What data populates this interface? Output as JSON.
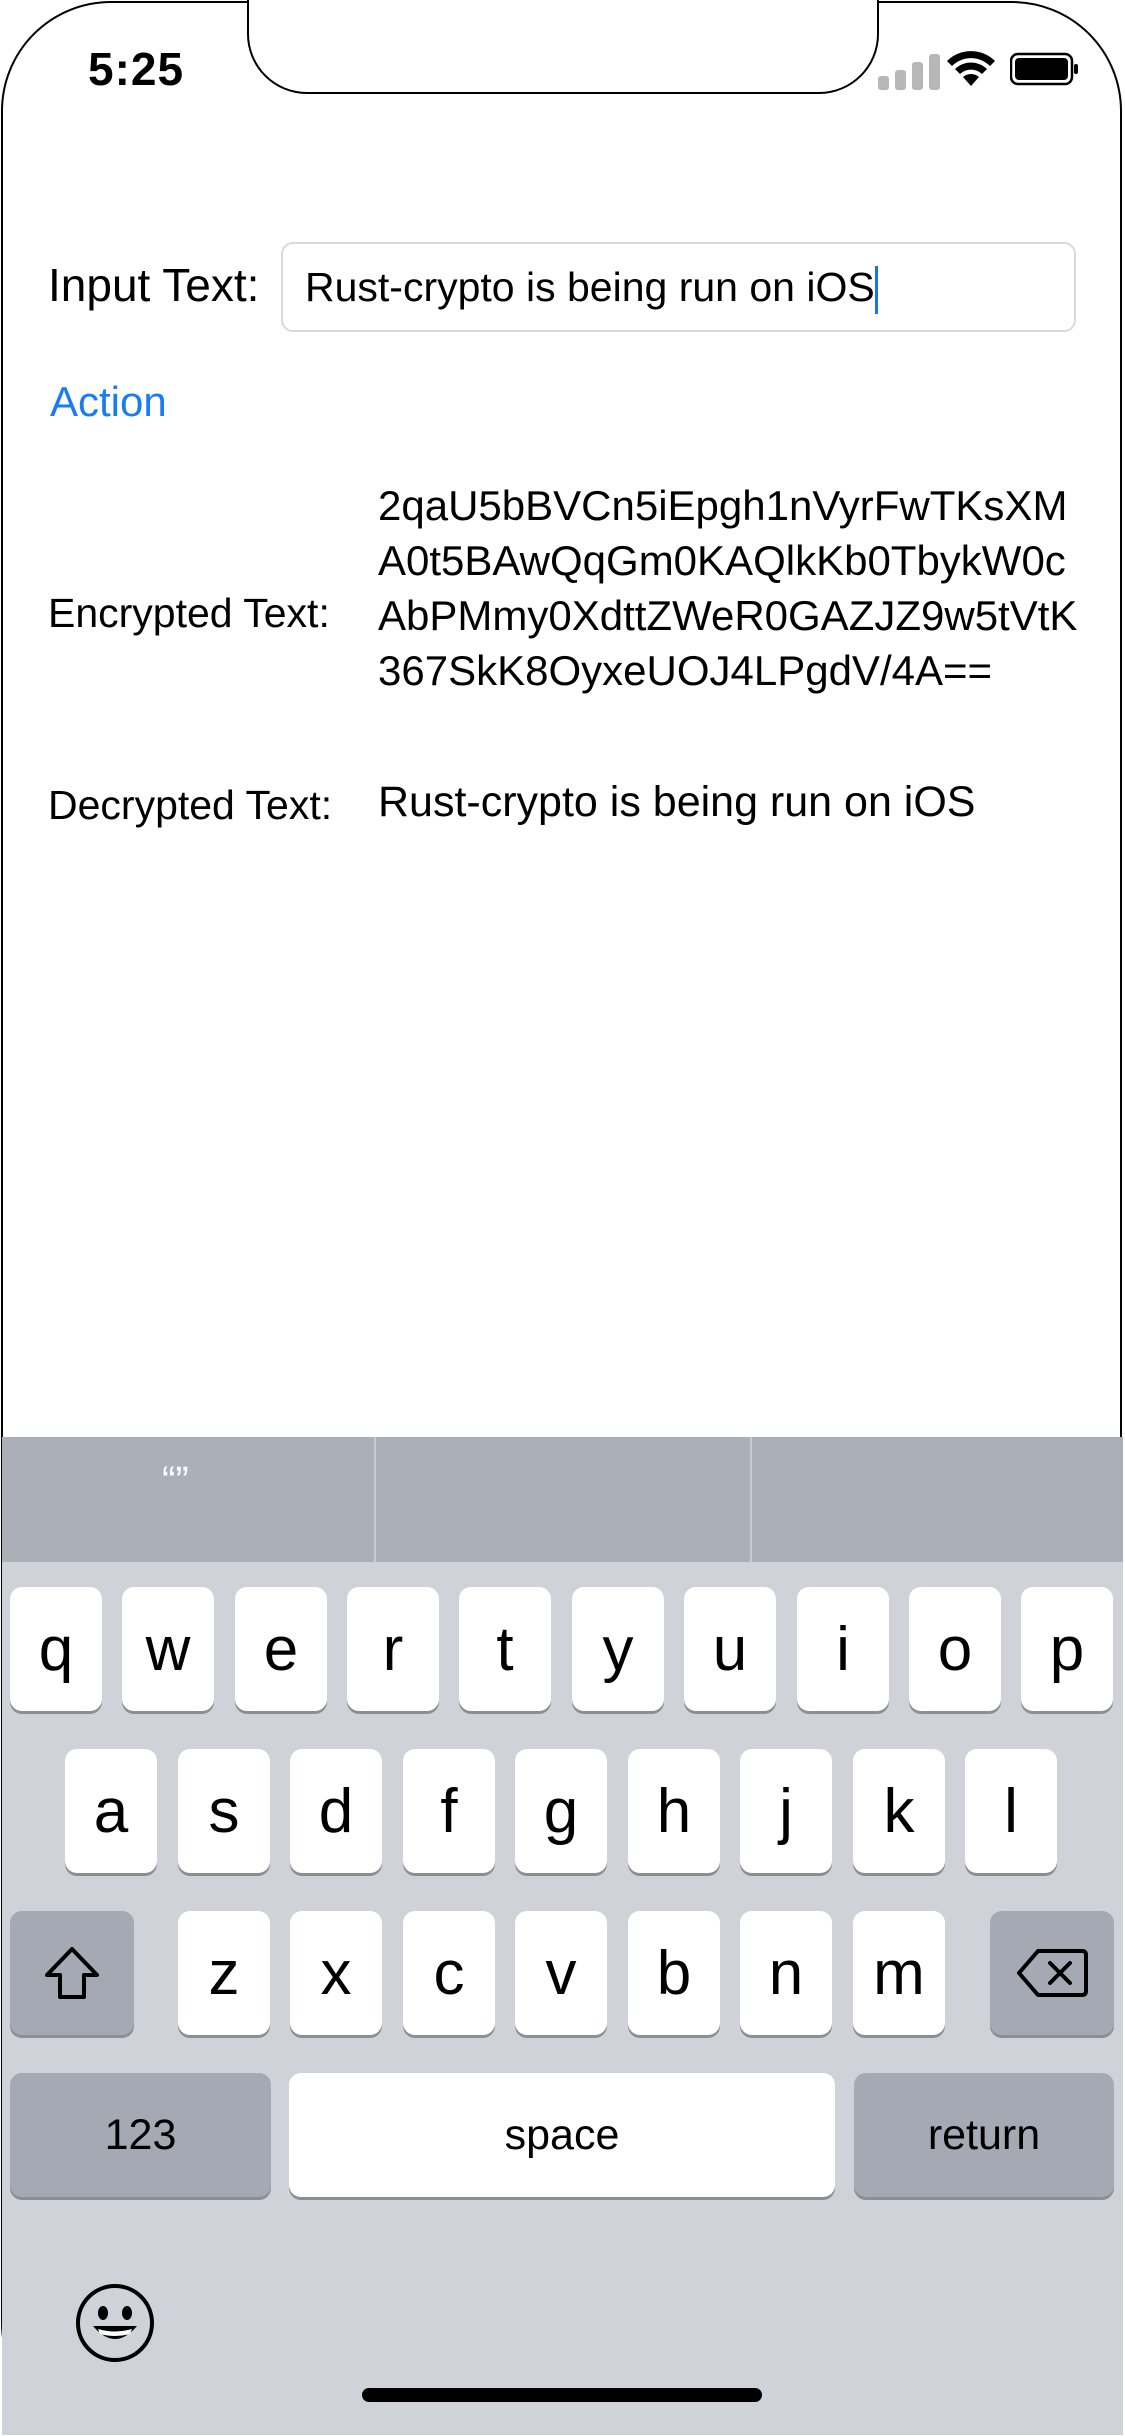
{
  "status_bar": {
    "time": "5:25"
  },
  "form": {
    "input_label": "Input Text:",
    "input_value": "Rust-crypto is being run on iOS",
    "action_label": "Action",
    "encrypted_label": "Encrypted Text:",
    "encrypted_value": "2qaU5bBVCn5iEpgh1nVyrFwTKsXMA0t5BAwQqGm0KAQlkKb0TbykW0cAbPMmy0XdttZWeR0GAZJZ9w5tVtK367SkK8OyxeUOJ4LPgdV/4A==",
    "decrypted_label": "Decrypted Text:",
    "decrypted_value": "Rust-crypto is being run on iOS"
  },
  "keyboard": {
    "prediction_1": "“”",
    "row1": [
      "q",
      "w",
      "e",
      "r",
      "t",
      "y",
      "u",
      "i",
      "o",
      "p"
    ],
    "row2": [
      "a",
      "s",
      "d",
      "f",
      "g",
      "h",
      "j",
      "k",
      "l"
    ],
    "row3": [
      "z",
      "x",
      "c",
      "v",
      "b",
      "n",
      "m"
    ],
    "numbers_key": "123",
    "space_key": "space",
    "return_key": "return",
    "icons": {
      "shift": "shift-icon",
      "delete": "delete-icon",
      "emoji": "emoji-icon"
    }
  }
}
